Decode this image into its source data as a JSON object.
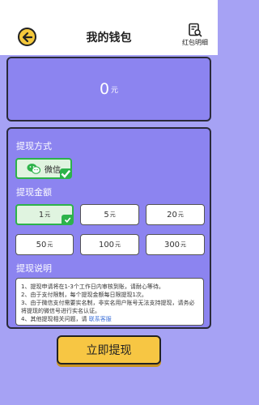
{
  "header": {
    "title": "我的钱包",
    "detail_label": "红包明细"
  },
  "balance": {
    "amount": "0",
    "unit": "元"
  },
  "method": {
    "section_label": "提现方式",
    "options": [
      {
        "label": "微信",
        "selected": true
      }
    ]
  },
  "amount": {
    "section_label": "提现金额",
    "unit": "元",
    "options": [
      {
        "value": "1",
        "selected": true
      },
      {
        "value": "5",
        "selected": false
      },
      {
        "value": "20",
        "selected": false
      },
      {
        "value": "50",
        "selected": false
      },
      {
        "value": "100",
        "selected": false
      },
      {
        "value": "300",
        "selected": false
      }
    ]
  },
  "notes": {
    "section_label": "提现说明",
    "line1": "1、提现申请将在1-3个工作日内审核到账，请耐心等待。",
    "line2": "2、由于支付限制，每个提现金额每日限提现1次。",
    "line3": "3、由于微信支付需要实名制，非实名用户账号无法支持提现，请务必将提现的微信号进行实名认证。",
    "line4": "4、其他提现相关问题，请",
    "link": "联系客服"
  },
  "submit": {
    "label": "立即提现"
  },
  "colors": {
    "background": "#a6a2f4",
    "panel": "#8c84f0",
    "accent": "#f7c643",
    "selected_border": "#2db34a",
    "link": "#3b6fd8"
  },
  "icons": {
    "back": "arrow-left-icon",
    "detail": "receipt-search-icon",
    "wechat": "wechat-icon",
    "check": "check-icon"
  }
}
